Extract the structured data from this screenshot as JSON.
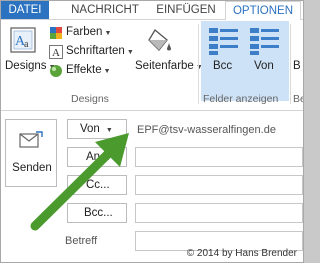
{
  "tabs": {
    "datei": "DATEI",
    "nachricht": "NACHRICHT",
    "einfuegen": "EINFÜGEN",
    "optionen": "OPTIONEN"
  },
  "ribbon": {
    "designs_group": {
      "designs_label": "Designs",
      "farben_label": "Farben",
      "schriftarten_label": "Schriftarten",
      "effekte_label": "Effekte",
      "seitenfarbe_label": "Seitenfarbe",
      "group_label": "Designs"
    },
    "felder_group": {
      "bcc_label": "Bcc",
      "von_label": "Von",
      "group_label": "Felder anzeigen"
    },
    "partial_right": {
      "b_label": "B",
      "group_partial": "Be"
    }
  },
  "compose": {
    "send_label": "Senden",
    "from_button": "Von",
    "from_address": "EPF@tsv-wasseralfingen.de",
    "to_button": "An...",
    "cc_button": "Cc...",
    "bcc_button": "Bcc...",
    "subject_label": "Betreff"
  },
  "watermark": "© 2014 by Hans Brender",
  "colors": {
    "accent_blue": "#2b72c0",
    "selected_group_bg": "#cde2f6",
    "arrow_green": "#4a9a2e"
  }
}
